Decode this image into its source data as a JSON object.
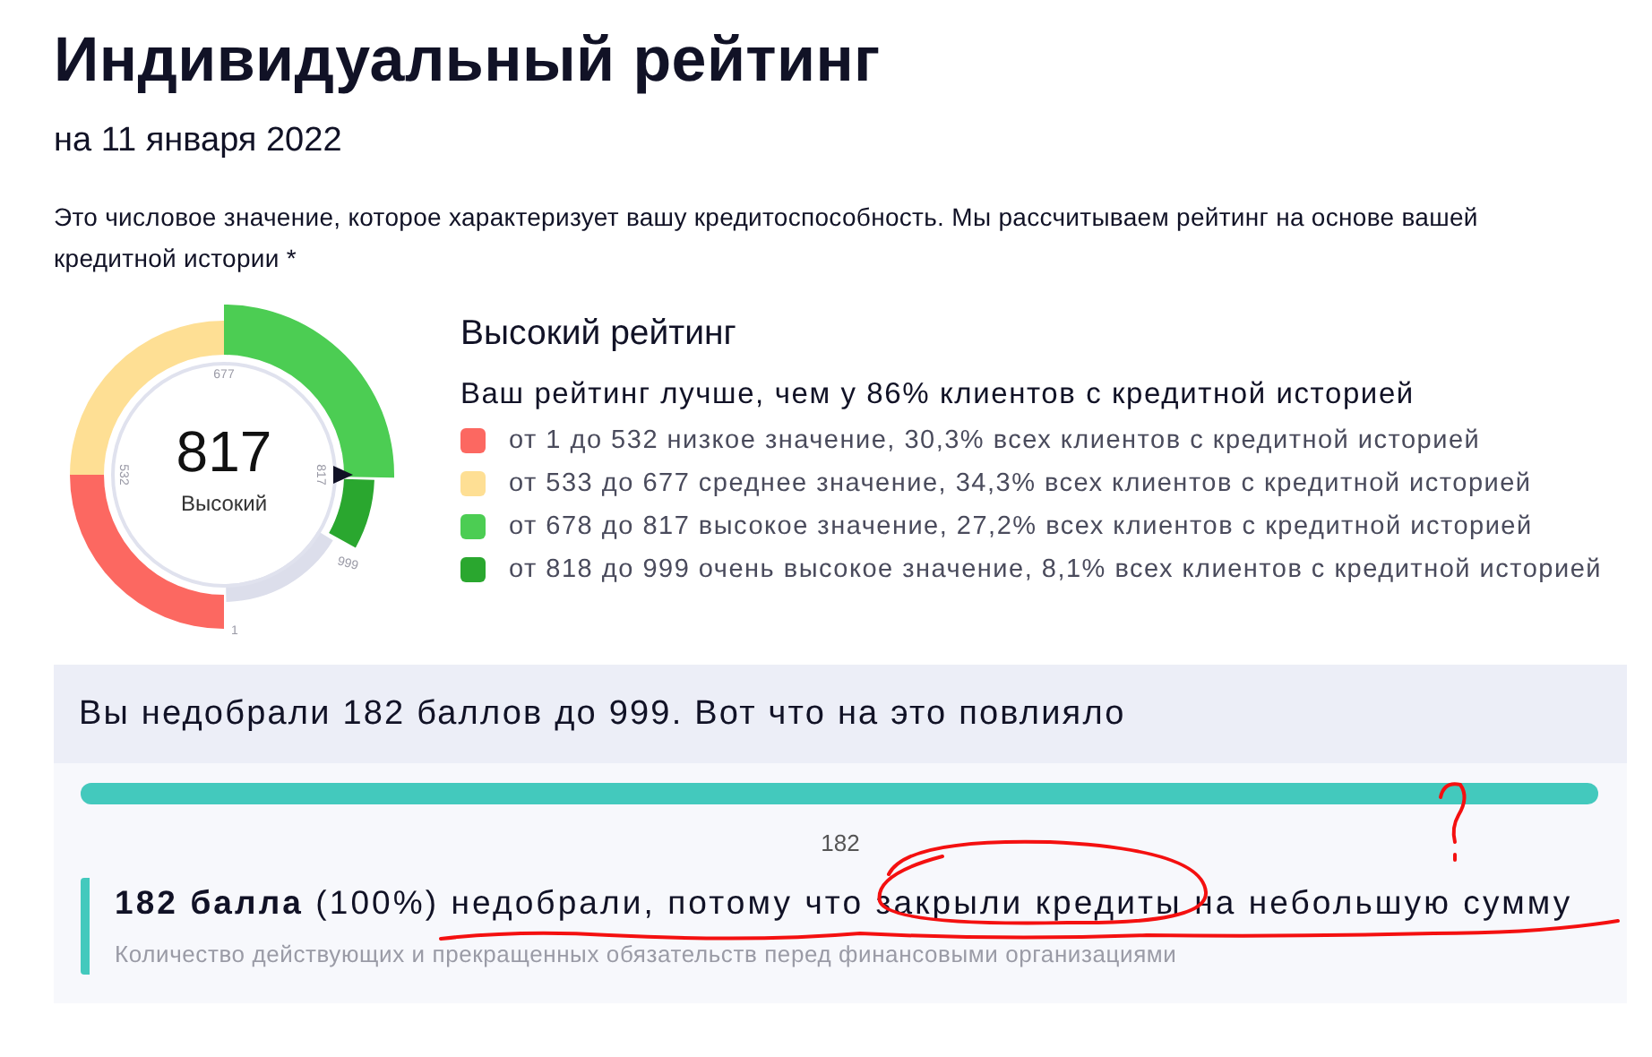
{
  "title": "Индивидуальный рейтинг",
  "date": "на 11 января 2022",
  "description": "Это числовое значение, которое характеризует вашу кредитоспособность. Мы рассчитываем рейтинг на основе вашей кредитной истории *",
  "gauge": {
    "score": "817",
    "label": "Высокий",
    "ticks": [
      "1",
      "532",
      "677",
      "817",
      "999"
    ]
  },
  "rating": {
    "title": "Высокий рейтинг",
    "subtitle": "Ваш рейтинг лучше, чем у 86% клиентов с кредитной историей",
    "legend": [
      {
        "text": "от 1 до 532 низкое значение, 30,3% всех клиентов с кредитной историей",
        "color": "#fc6861"
      },
      {
        "text": "от 533 до 677 среднее значение, 34,3% всех клиентов с кредитной историей",
        "color": "#fedf94"
      },
      {
        "text": "от 678 до 817 высокое значение, 27,2% всех клиентов с кредитной историей",
        "color": "#4ccd53"
      },
      {
        "text": "от 818 до 999 очень высокое значение, 8,1% всех клиентов с кредитной историей",
        "color": "#2aa72f"
      }
    ]
  },
  "factors": {
    "heading": "Вы недобрали 182 баллов до 999. Вот что на это повлияло",
    "progress": {
      "level": 1,
      "label": "182"
    },
    "items": [
      {
        "text": "**182 балла** (100%) недобрали, потому что закрыли кредиты на небольшую сумму",
        "detail": "Количество действующих и прекращенных обязательств перед финансовыми организациями"
      }
    ]
  }
}
